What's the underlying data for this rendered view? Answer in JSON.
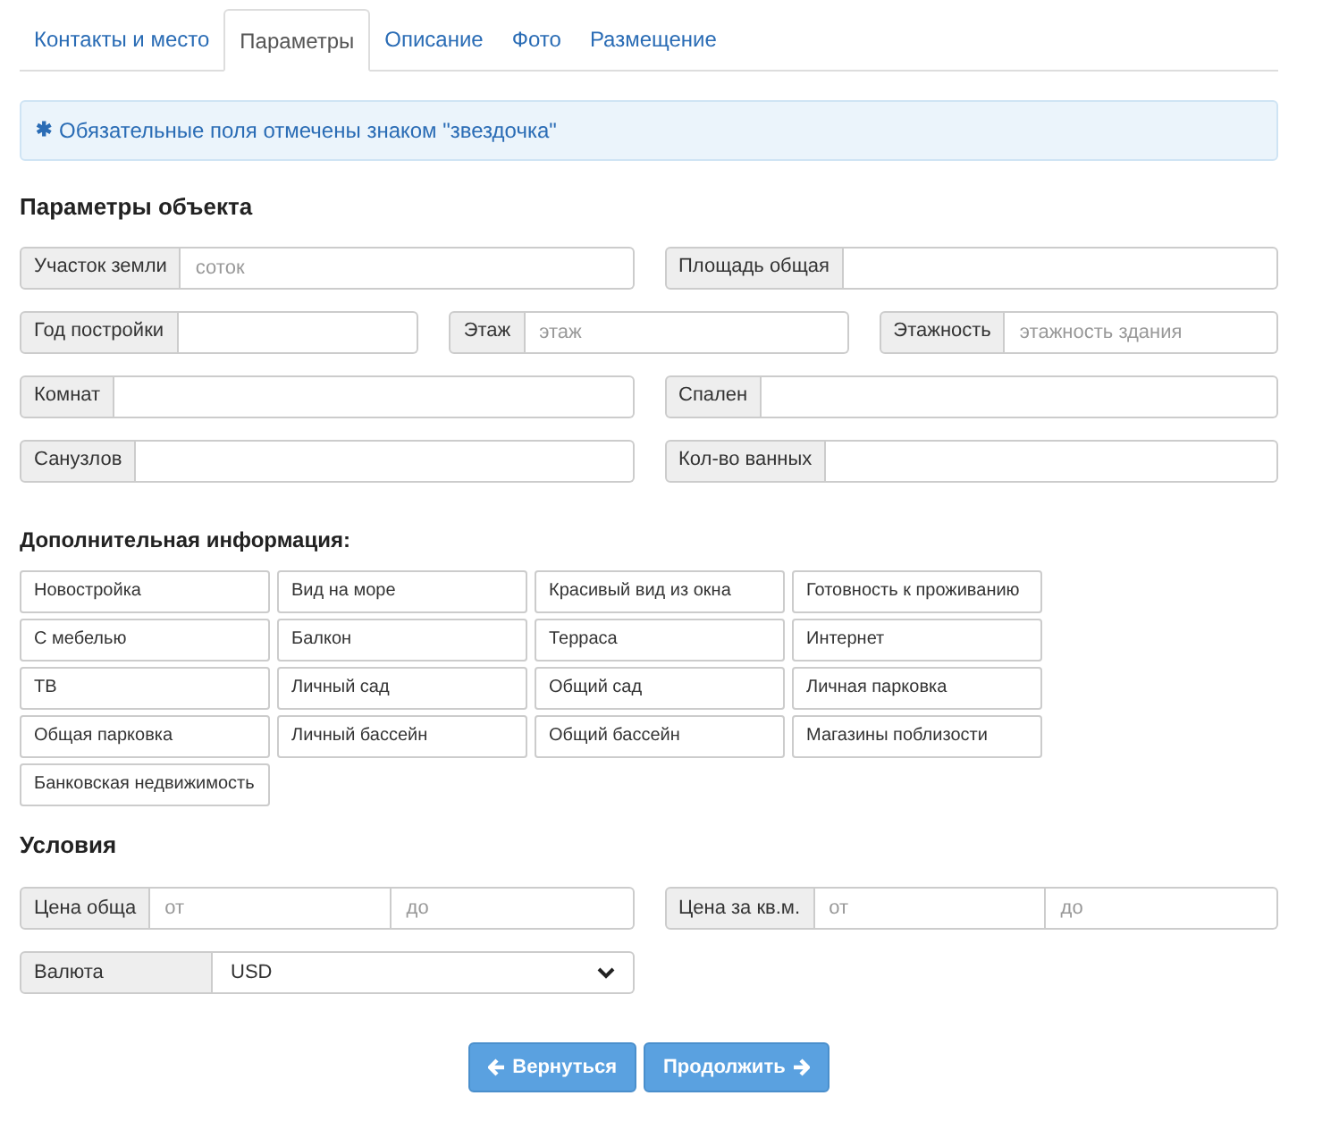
{
  "tabs": [
    {
      "label": "Контакты и место",
      "selected": false
    },
    {
      "label": "Параметры",
      "selected": true
    },
    {
      "label": "Описание",
      "selected": false
    },
    {
      "label": "Фото",
      "selected": false
    },
    {
      "label": "Размещение",
      "selected": false
    }
  ],
  "notice": {
    "icon": "✱",
    "text": "Обязательные поля отмечены знаком \"звездочка\""
  },
  "object_params": {
    "title": "Параметры объекта",
    "rows": [
      [
        {
          "label": "Участок земли",
          "placeholder": "соток"
        },
        {
          "label": "Площадь общая"
        }
      ],
      [
        {
          "label": "Год постройки"
        },
        {
          "label": "Этаж",
          "placeholder": "этаж"
        },
        {
          "label": "Этажность",
          "placeholder": "этажность здания"
        }
      ],
      [
        {
          "label": "Комнат"
        },
        {
          "label": "Спален"
        }
      ],
      [
        {
          "label": "Санузлов"
        },
        {
          "label": "Кол-во ванных"
        }
      ]
    ]
  },
  "extra_info": {
    "title": "Дополнительная информация:",
    "options": [
      "Новостройка",
      "Вид на море",
      "Красивый вид из окна",
      "Готовность к проживанию",
      "С мебелью",
      "Балкон",
      "Терраса",
      "Интернет",
      "ТВ",
      "Личный сад",
      "Общий сад",
      "Личная парковка",
      "Общая парковка",
      "Личный бассейн",
      "Общий бассейн",
      "Магазины поблизости",
      "Банковская недвижимость"
    ]
  },
  "conditions": {
    "title": "Условия",
    "prices": [
      {
        "label": "Цена обща",
        "from_placeholder": "от",
        "to_placeholder": "до"
      },
      {
        "label": "Цена за кв.м.",
        "from_placeholder": "от",
        "to_placeholder": "до"
      }
    ],
    "currency": {
      "label": "Валюта",
      "value": "USD"
    }
  },
  "buttons": [
    {
      "kind": "back",
      "label": "Вернуться"
    },
    {
      "kind": "next",
      "label": "Продолжить"
    }
  ]
}
